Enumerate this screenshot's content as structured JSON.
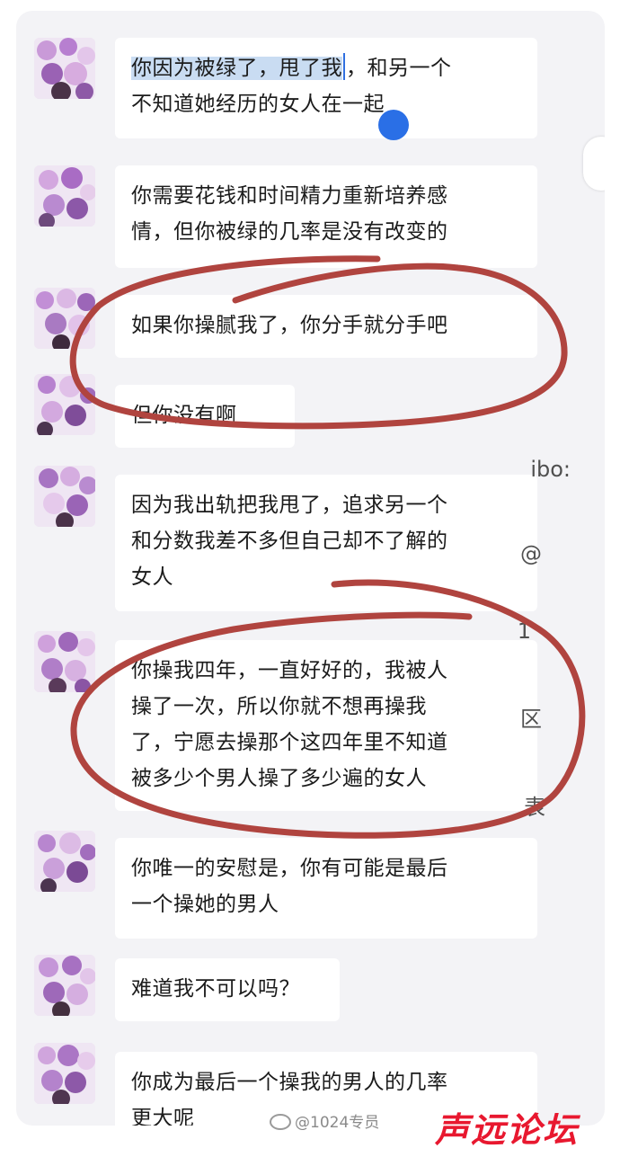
{
  "messages": [
    {
      "text_selected": "你因为被绿了，甩了我",
      "text_rest": "，和另一个\n不知道她经历的女人在一起"
    },
    {
      "text": "你需要花钱和时间精力重新培养感\n情，但你被绿的几率是没有改变的"
    },
    {
      "text": "如果你操腻我了，你分手就分手吧"
    },
    {
      "text": "但你没有啊"
    },
    {
      "text": "因为我出轨把我甩了，追求另一个\n和分数我差不多但自己却不了解的\n女人"
    },
    {
      "text": "你操我四年，一直好好的，我被人\n操了一次，所以你就不想再操我\n了，宁愿去操那个这四年里不知道\n被多少个男人操了多少遍的女人"
    },
    {
      "text": "你唯一的安慰是，你有可能是最后\n一个操她的男人"
    },
    {
      "text": "难道我不可以吗？"
    },
    {
      "text": "你成为最后一个操我的男人的几率\n更大呢"
    }
  ],
  "side_fragments": [
    "ibo:",
    "@",
    "1",
    "区",
    "表"
  ],
  "watermark": {
    "weibo": "@1024专员",
    "brand": "声远论坛"
  },
  "colors": {
    "annotation_circle": "#b0443f",
    "selection": "#c9dcf2",
    "handle": "#2a6fe6",
    "brand": "#e8182f"
  }
}
